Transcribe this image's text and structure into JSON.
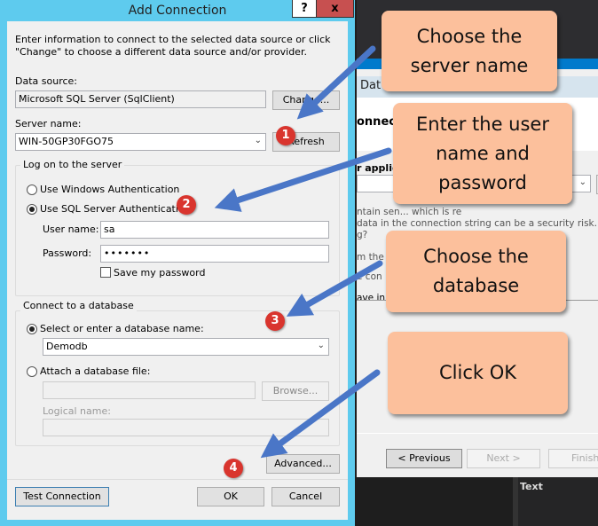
{
  "background": {
    "header": "Dat",
    "section": "onnect",
    "applica": "r applica",
    "line1": "ntain sen... which is re",
    "line2": "data in the connection string can be a security risk. Do yo",
    "line3": "g?",
    "line4": "m the c                                   in my a",
    "line5": "e con",
    "line6": "ave in t",
    "previous": "< Previous",
    "next": "Next >",
    "finish": "Finish",
    "text_label": "Text"
  },
  "dialog": {
    "title": "Add Connection",
    "help": "?",
    "close": "x",
    "description": "Enter information to connect to the selected data source or click \"Change\" to choose a different data source and/or provider.",
    "data_source_label": "Data source:",
    "data_source_value": "Microsoft SQL Server (SqlClient)",
    "change": "Change...",
    "server_name_label": "Server name:",
    "server_name_value": "WIN-50GP30FGO75",
    "refresh": "Refresh",
    "logon_group": "Log on to the server",
    "windows_auth": "Use Windows Authentication",
    "sql_auth": "Use SQL Server Authentication",
    "auth_selected": "sql",
    "user_name_label": "User name:",
    "user_name_value": "sa",
    "password_label": "Password:",
    "password_value": "•••••••",
    "save_password": "Save my password",
    "save_password_checked": false,
    "db_group": "Connect to a database",
    "select_db": "Select or enter a database name:",
    "db_value": "Demodb",
    "attach_db": "Attach a database file:",
    "browse": "Browse...",
    "logical_name_label": "Logical name:",
    "advanced": "Advanced...",
    "test_connection": "Test Connection",
    "ok": "OK",
    "cancel": "Cancel"
  },
  "callouts": [
    {
      "number": "1",
      "text": "Choose the server name"
    },
    {
      "number": "2",
      "text": "Enter the user name and password"
    },
    {
      "number": "3",
      "text": "Choose the database"
    },
    {
      "number": "4",
      "text": "Click OK"
    }
  ],
  "colors": {
    "callout": "#fcc09c",
    "arrow": "#4a76c7",
    "badge": "#d9352e",
    "window_border": "#5ecbee"
  }
}
